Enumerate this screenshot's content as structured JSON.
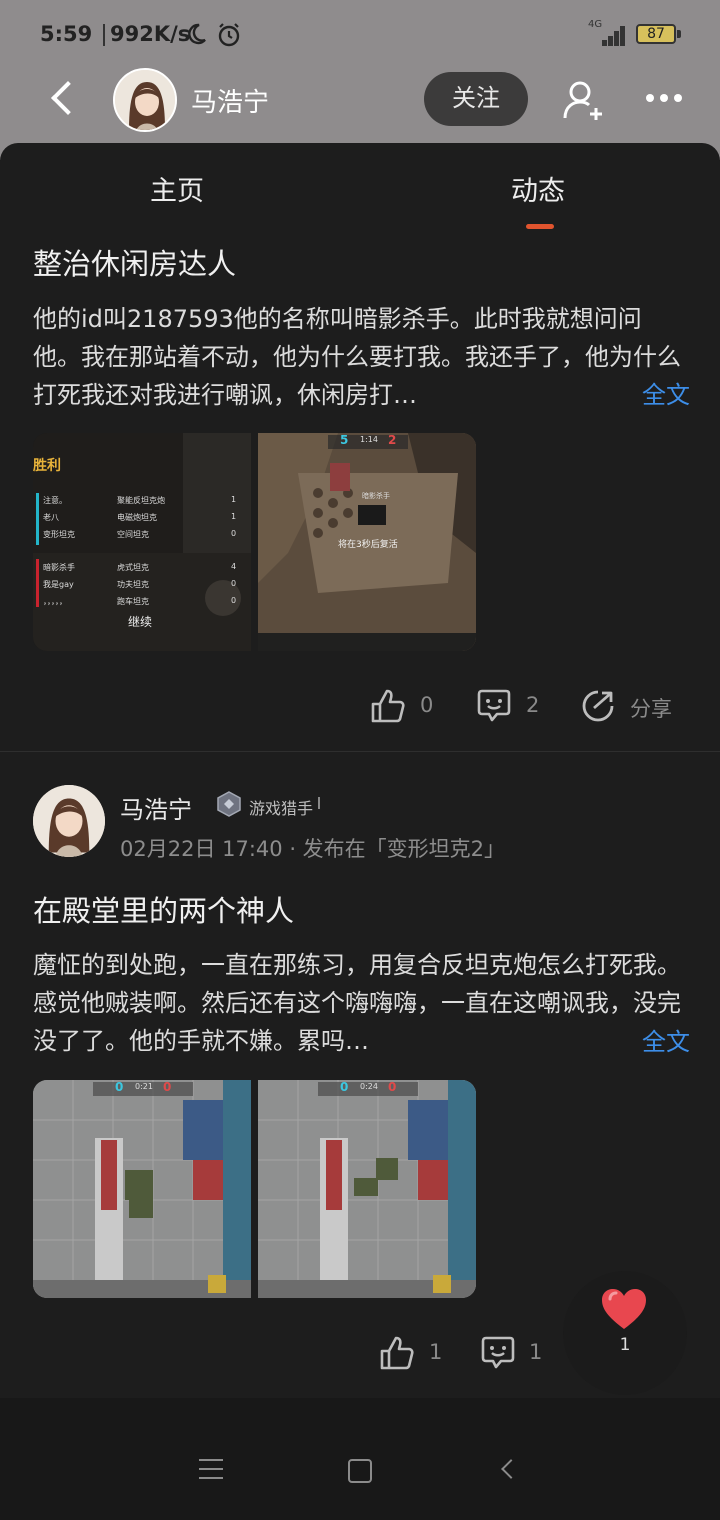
{
  "status": {
    "time": "5:59",
    "speed": "992K/s",
    "network": "4G",
    "battery": "87"
  },
  "header": {
    "name": "马浩宁",
    "follow_label": "关注"
  },
  "tabs": [
    {
      "label": "主页"
    },
    {
      "label": "动态"
    }
  ],
  "posts": [
    {
      "title": "整治休闲房达人",
      "body": "他的id叫2187593他的名称叫暗影杀手。此时我就想问问他。我在那站着不动，他为什么要打我。我还手了，他为什么打死我还对我进行嘲讽，休闲房打…",
      "full_label": "全文",
      "images": [
        {
          "victory": "胜利",
          "rows": [
            {
              "name": "注意。",
              "tank": "聚能反坦克炮",
              "score": "1"
            },
            {
              "name": "老八",
              "tank": "电磁炮坦克",
              "score": "1"
            },
            {
              "name": "变形坦克",
              "tank": "空间坦克",
              "score": "0"
            },
            {
              "name": "暗影杀手",
              "tank": "虎式坦克",
              "score": "4"
            },
            {
              "name": "我是gay",
              "tank": "功夫坦克",
              "score": "0"
            },
            {
              "name": "，，，，，",
              "tank": "跑车坦克",
              "score": "0"
            }
          ],
          "continue": "继续"
        },
        {
          "score_left": "5",
          "timer": "1:14",
          "score_right": "2",
          "player_tag": "暗影杀手",
          "respawn": "将在3秒后复活"
        }
      ],
      "likes": "0",
      "comments": "2",
      "share_label": "分享"
    },
    {
      "author": "马浩宁",
      "badge": "游戏猎手",
      "date": "02月22日 17:40",
      "published_in": "· 发布在「变形坦克2」",
      "title": "在殿堂里的两个神人",
      "body": "魔怔的到处跑，一直在那练习，用复合反坦克炮怎么打死我。感觉他贼装啊。然后还有这个嗨嗨嗨，一直在这嘲讽我，没完没了了。他的手就不嫌。累吗…",
      "full_label": "全文",
      "images": [
        {
          "score_left": "0",
          "timer": "0:21",
          "score_right": "0"
        },
        {
          "score_left": "0",
          "timer": "0:24",
          "score_right": "0"
        }
      ],
      "likes": "1",
      "comments": "1"
    }
  ],
  "fab": {
    "count": "1"
  },
  "colors": {
    "accent": "#e0542e",
    "link": "#3d8ee8",
    "sheet": "#1d1d1d",
    "header_bg": "#8f8c8d"
  }
}
